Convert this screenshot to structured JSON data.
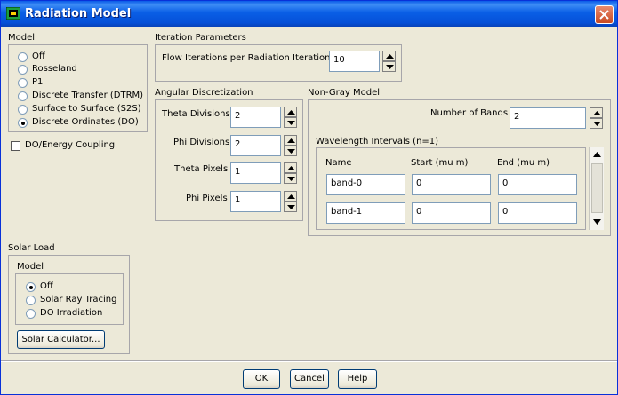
{
  "window": {
    "title": "Radiation Model"
  },
  "model_group": {
    "label": "Model",
    "options": [
      {
        "label": "Off",
        "selected": false
      },
      {
        "label": "Rosseland",
        "selected": false
      },
      {
        "label": "P1",
        "selected": false
      },
      {
        "label": "Discrete Transfer (DTRM)",
        "selected": false
      },
      {
        "label": "Surface to Surface (S2S)",
        "selected": false
      },
      {
        "label": "Discrete Ordinates (DO)",
        "selected": true
      }
    ]
  },
  "do_energy_coupling": {
    "label": "DO/Energy Coupling",
    "checked": false
  },
  "iteration": {
    "label": "Iteration Parameters",
    "field_label": "Flow Iterations per Radiation Iteration",
    "value": "10"
  },
  "angular": {
    "label": "Angular Discretization",
    "fields": [
      {
        "label": "Theta Divisions",
        "value": "2"
      },
      {
        "label": "Phi Divisions",
        "value": "2"
      },
      {
        "label": "Theta Pixels",
        "value": "1"
      },
      {
        "label": "Phi Pixels",
        "value": "1"
      }
    ]
  },
  "nongray": {
    "label": "Non-Gray Model",
    "bands_label": "Number of Bands",
    "bands_value": "2",
    "intervals_label": "Wavelength Intervals (n=1)",
    "columns": [
      "Name",
      "Start (mu m)",
      "End (mu m)"
    ],
    "rows": [
      {
        "name": "band-0",
        "start": "0",
        "end": "0"
      },
      {
        "name": "band-1",
        "start": "0",
        "end": "0"
      }
    ]
  },
  "solar": {
    "label": "Solar Load",
    "model_label": "Model",
    "options": [
      {
        "label": "Off",
        "selected": true
      },
      {
        "label": "Solar Ray Tracing",
        "selected": false
      },
      {
        "label": "DO Irradiation",
        "selected": false
      }
    ],
    "calculator_label": "Solar Calculator..."
  },
  "buttons": {
    "ok": "OK",
    "cancel": "Cancel",
    "help": "Help"
  }
}
